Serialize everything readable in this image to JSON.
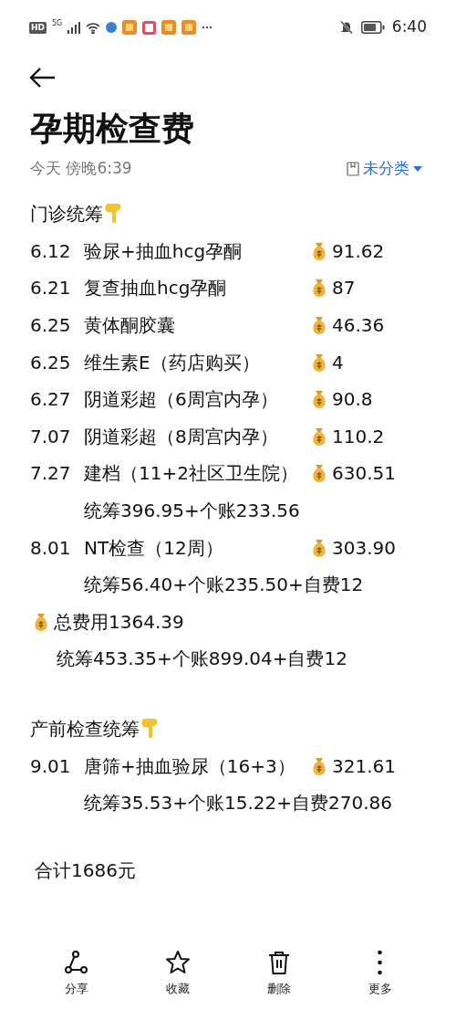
{
  "status_bar": {
    "hd": "HD",
    "network": "5G",
    "time": "6:40"
  },
  "title": "孕期检查费",
  "timestamp": "今天 傍晚6:39",
  "folder": "未分类",
  "sections": [
    {
      "title": "门诊统筹",
      "entries": [
        {
          "kind": "expense",
          "date": "6.12",
          "name": "验尿+抽血hcg孕酮",
          "amount": "91.62"
        },
        {
          "kind": "expense",
          "date": "6.21",
          "name": "复查抽血hcg孕酮",
          "amount": "87"
        },
        {
          "kind": "expense",
          "date": "6.25",
          "name": "黄体酮胶囊",
          "amount": "46.36"
        },
        {
          "kind": "expense",
          "date": "6.25",
          "name": "维生素E（药店购买）",
          "amount": "4"
        },
        {
          "kind": "expense",
          "date": "6.27",
          "name": "阴道彩超（6周宫内孕）",
          "amount": "90.8"
        },
        {
          "kind": "expense",
          "date": "7.07",
          "name": "阴道彩超（8周宫内孕）",
          "amount": "110.2"
        },
        {
          "kind": "expense",
          "date": "7.27",
          "name": "建档（11+2社区卫生院）",
          "amount": "630.51"
        },
        {
          "kind": "detail",
          "text": "统筹396.95+个账233.56"
        },
        {
          "kind": "expense",
          "date": "8.01",
          "name": "NT检查（12周）",
          "amount": "303.90"
        },
        {
          "kind": "detail",
          "text": "统筹56.40+个账235.50+自费12"
        },
        {
          "kind": "total",
          "text": "总费用1364.39"
        },
        {
          "kind": "total_detail",
          "text": "统筹453.35+个账899.04+自费12"
        }
      ]
    },
    {
      "title": "产前检查统筹",
      "entries": [
        {
          "kind": "expense",
          "date": "9.01",
          "name": "唐筛+抽血验尿（16+3）",
          "amount": "321.61"
        },
        {
          "kind": "detail",
          "text": "统筹35.53+个账15.22+自费270.86"
        }
      ]
    }
  ],
  "grand_total": "合计1686元",
  "toolbar": [
    {
      "kind": "share",
      "label": "分享"
    },
    {
      "kind": "favorite",
      "label": "收藏"
    },
    {
      "kind": "delete",
      "label": "删除"
    },
    {
      "kind": "more",
      "label": "更多"
    }
  ]
}
